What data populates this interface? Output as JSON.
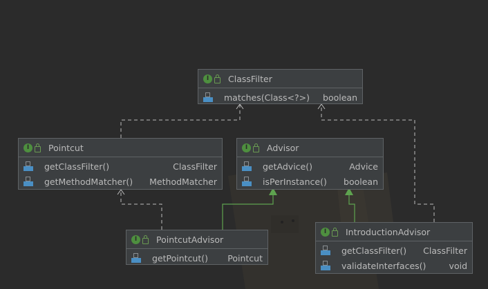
{
  "diagram": {
    "classes": {
      "class_filter": {
        "name": "ClassFilter",
        "methods": [
          {
            "name": "matches(Class<?>)",
            "type": "boolean"
          }
        ]
      },
      "pointcut": {
        "name": "Pointcut",
        "methods": [
          {
            "name": "getClassFilter()",
            "type": "ClassFilter"
          },
          {
            "name": "getMethodMatcher()",
            "type": "MethodMatcher"
          }
        ]
      },
      "advisor": {
        "name": "Advisor",
        "methods": [
          {
            "name": "getAdvice()",
            "type": "Advice"
          },
          {
            "name": "isPerInstance()",
            "type": "boolean"
          }
        ]
      },
      "pointcut_advisor": {
        "name": "PointcutAdvisor",
        "methods": [
          {
            "name": "getPointcut()",
            "type": "Pointcut"
          }
        ]
      },
      "introduction_advisor": {
        "name": "IntroductionAdvisor",
        "methods": [
          {
            "name": "getClassFilter()",
            "type": "ClassFilter"
          },
          {
            "name": "validateInterfaces()",
            "type": "void"
          }
        ]
      }
    },
    "relations": [
      {
        "from": "Pointcut",
        "to": "ClassFilter",
        "kind": "dependency"
      },
      {
        "from": "IntroductionAdvisor",
        "to": "ClassFilter",
        "kind": "dependency"
      },
      {
        "from": "PointcutAdvisor",
        "to": "Pointcut",
        "kind": "dependency"
      },
      {
        "from": "PointcutAdvisor",
        "to": "Advisor",
        "kind": "extends"
      },
      {
        "from": "IntroductionAdvisor",
        "to": "Advisor",
        "kind": "extends"
      }
    ],
    "icons": {
      "interface": "interface-icon",
      "visibility": "lock-icon",
      "method": "method-icon"
    },
    "colors": {
      "background": "#2b2b2b",
      "box": "#3c3f41",
      "border": "#5f6366",
      "text": "#bbbbbb",
      "extends_line": "#5ea34f",
      "dependency_line": "#bdbdbd"
    }
  }
}
